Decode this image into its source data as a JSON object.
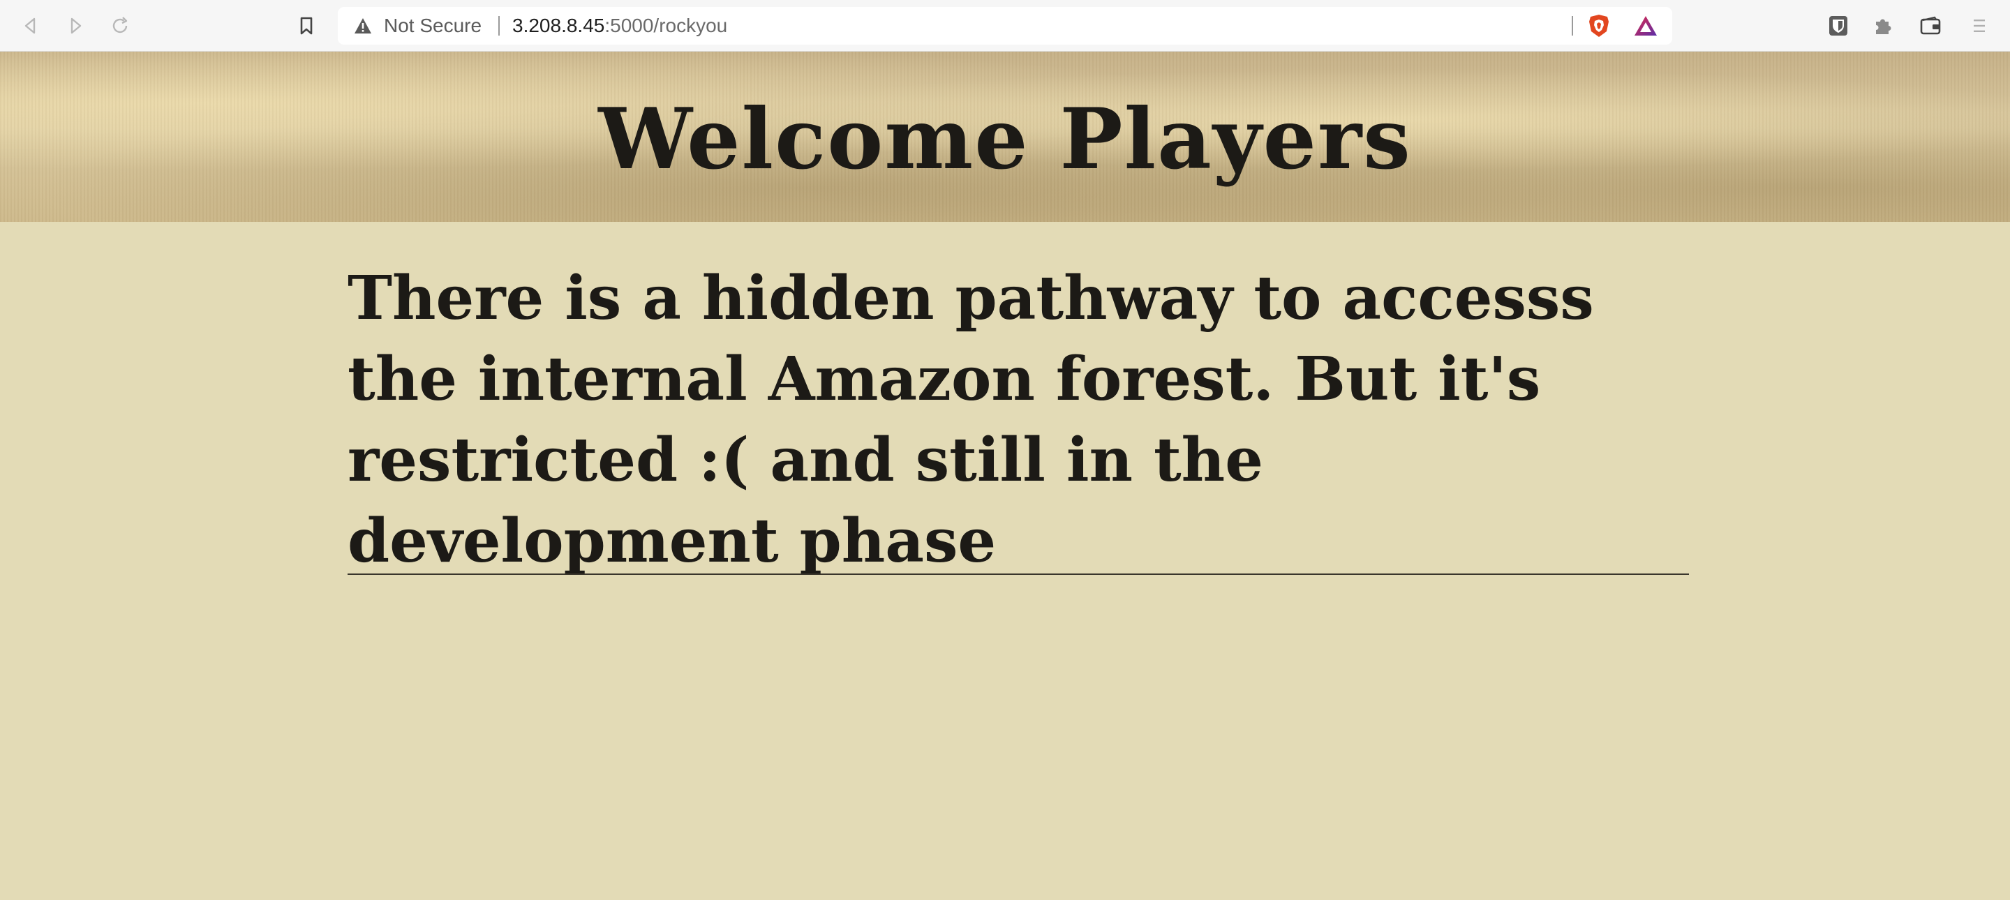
{
  "browser": {
    "security_label": "Not Secure",
    "url_host": "3.208.8.45",
    "url_path": ":5000/rockyou",
    "icons": [
      "back-icon",
      "forward-icon",
      "reload-icon",
      "bookmark-icon",
      "warning-icon",
      "brave-shield-icon",
      "brave-rewards-icon",
      "bitwarden-icon",
      "extensions-icon",
      "wallet-icon",
      "menu-icon"
    ]
  },
  "page": {
    "title": "Welcome Players",
    "message": "There is a hidden pathway to accesss the internal Amazon forest. But it's restricted :( and still in the development phase"
  }
}
